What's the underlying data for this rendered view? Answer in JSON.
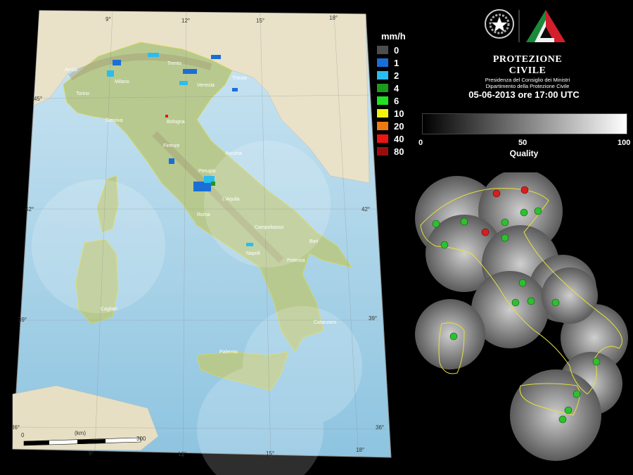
{
  "map": {
    "lon_ticks": [
      "9°",
      "12°",
      "15°",
      "18°"
    ],
    "lat_ticks": [
      "45°",
      "42°",
      "39°",
      "36°"
    ],
    "cities": [
      {
        "name": "Aosta"
      },
      {
        "name": "Milano"
      },
      {
        "name": "Trento"
      },
      {
        "name": "Trieste"
      },
      {
        "name": "Venezia"
      },
      {
        "name": "Torino"
      },
      {
        "name": "Genova"
      },
      {
        "name": "Bologna"
      },
      {
        "name": "Firenze"
      },
      {
        "name": "Ancona"
      },
      {
        "name": "Perugia"
      },
      {
        "name": "L'Aquila"
      },
      {
        "name": "Roma"
      },
      {
        "name": "Campobasso"
      },
      {
        "name": "Napoli"
      },
      {
        "name": "Potenza"
      },
      {
        "name": "Bari"
      },
      {
        "name": "Cagliari"
      },
      {
        "name": "Catanzaro"
      },
      {
        "name": "Palermo"
      }
    ],
    "scale_bar": {
      "start": "0",
      "unit": "(km)",
      "end": "300"
    }
  },
  "legend": {
    "unit": "mm/h",
    "items": [
      {
        "label": "0",
        "color": "#4d4d4d"
      },
      {
        "label": "1",
        "color": "#1a6fd6"
      },
      {
        "label": "2",
        "color": "#2bbcf0"
      },
      {
        "label": "4",
        "color": "#1d9a1d"
      },
      {
        "label": "6",
        "color": "#22e022"
      },
      {
        "label": "10",
        "color": "#f2f20d"
      },
      {
        "label": "20",
        "color": "#f07a12"
      },
      {
        "label": "40",
        "color": "#ea1515"
      },
      {
        "label": "80",
        "color": "#9b0d0d"
      }
    ]
  },
  "header": {
    "org_title": "PROTEZIONE CIVILE",
    "org_sub1": "Presidenza del Consiglio dei Ministri",
    "org_sub2": "Dipartimento della Protezione Civile",
    "datetime": "05-06-2013 ore 17:00 UTC"
  },
  "quality": {
    "min": "0",
    "mid": "50",
    "max": "100",
    "label": "Quality"
  },
  "icons": {
    "emblem": "italian-republic-emblem-icon",
    "logo": "protezione-civile-logo-icon",
    "radar": "radar-dish-icon"
  }
}
